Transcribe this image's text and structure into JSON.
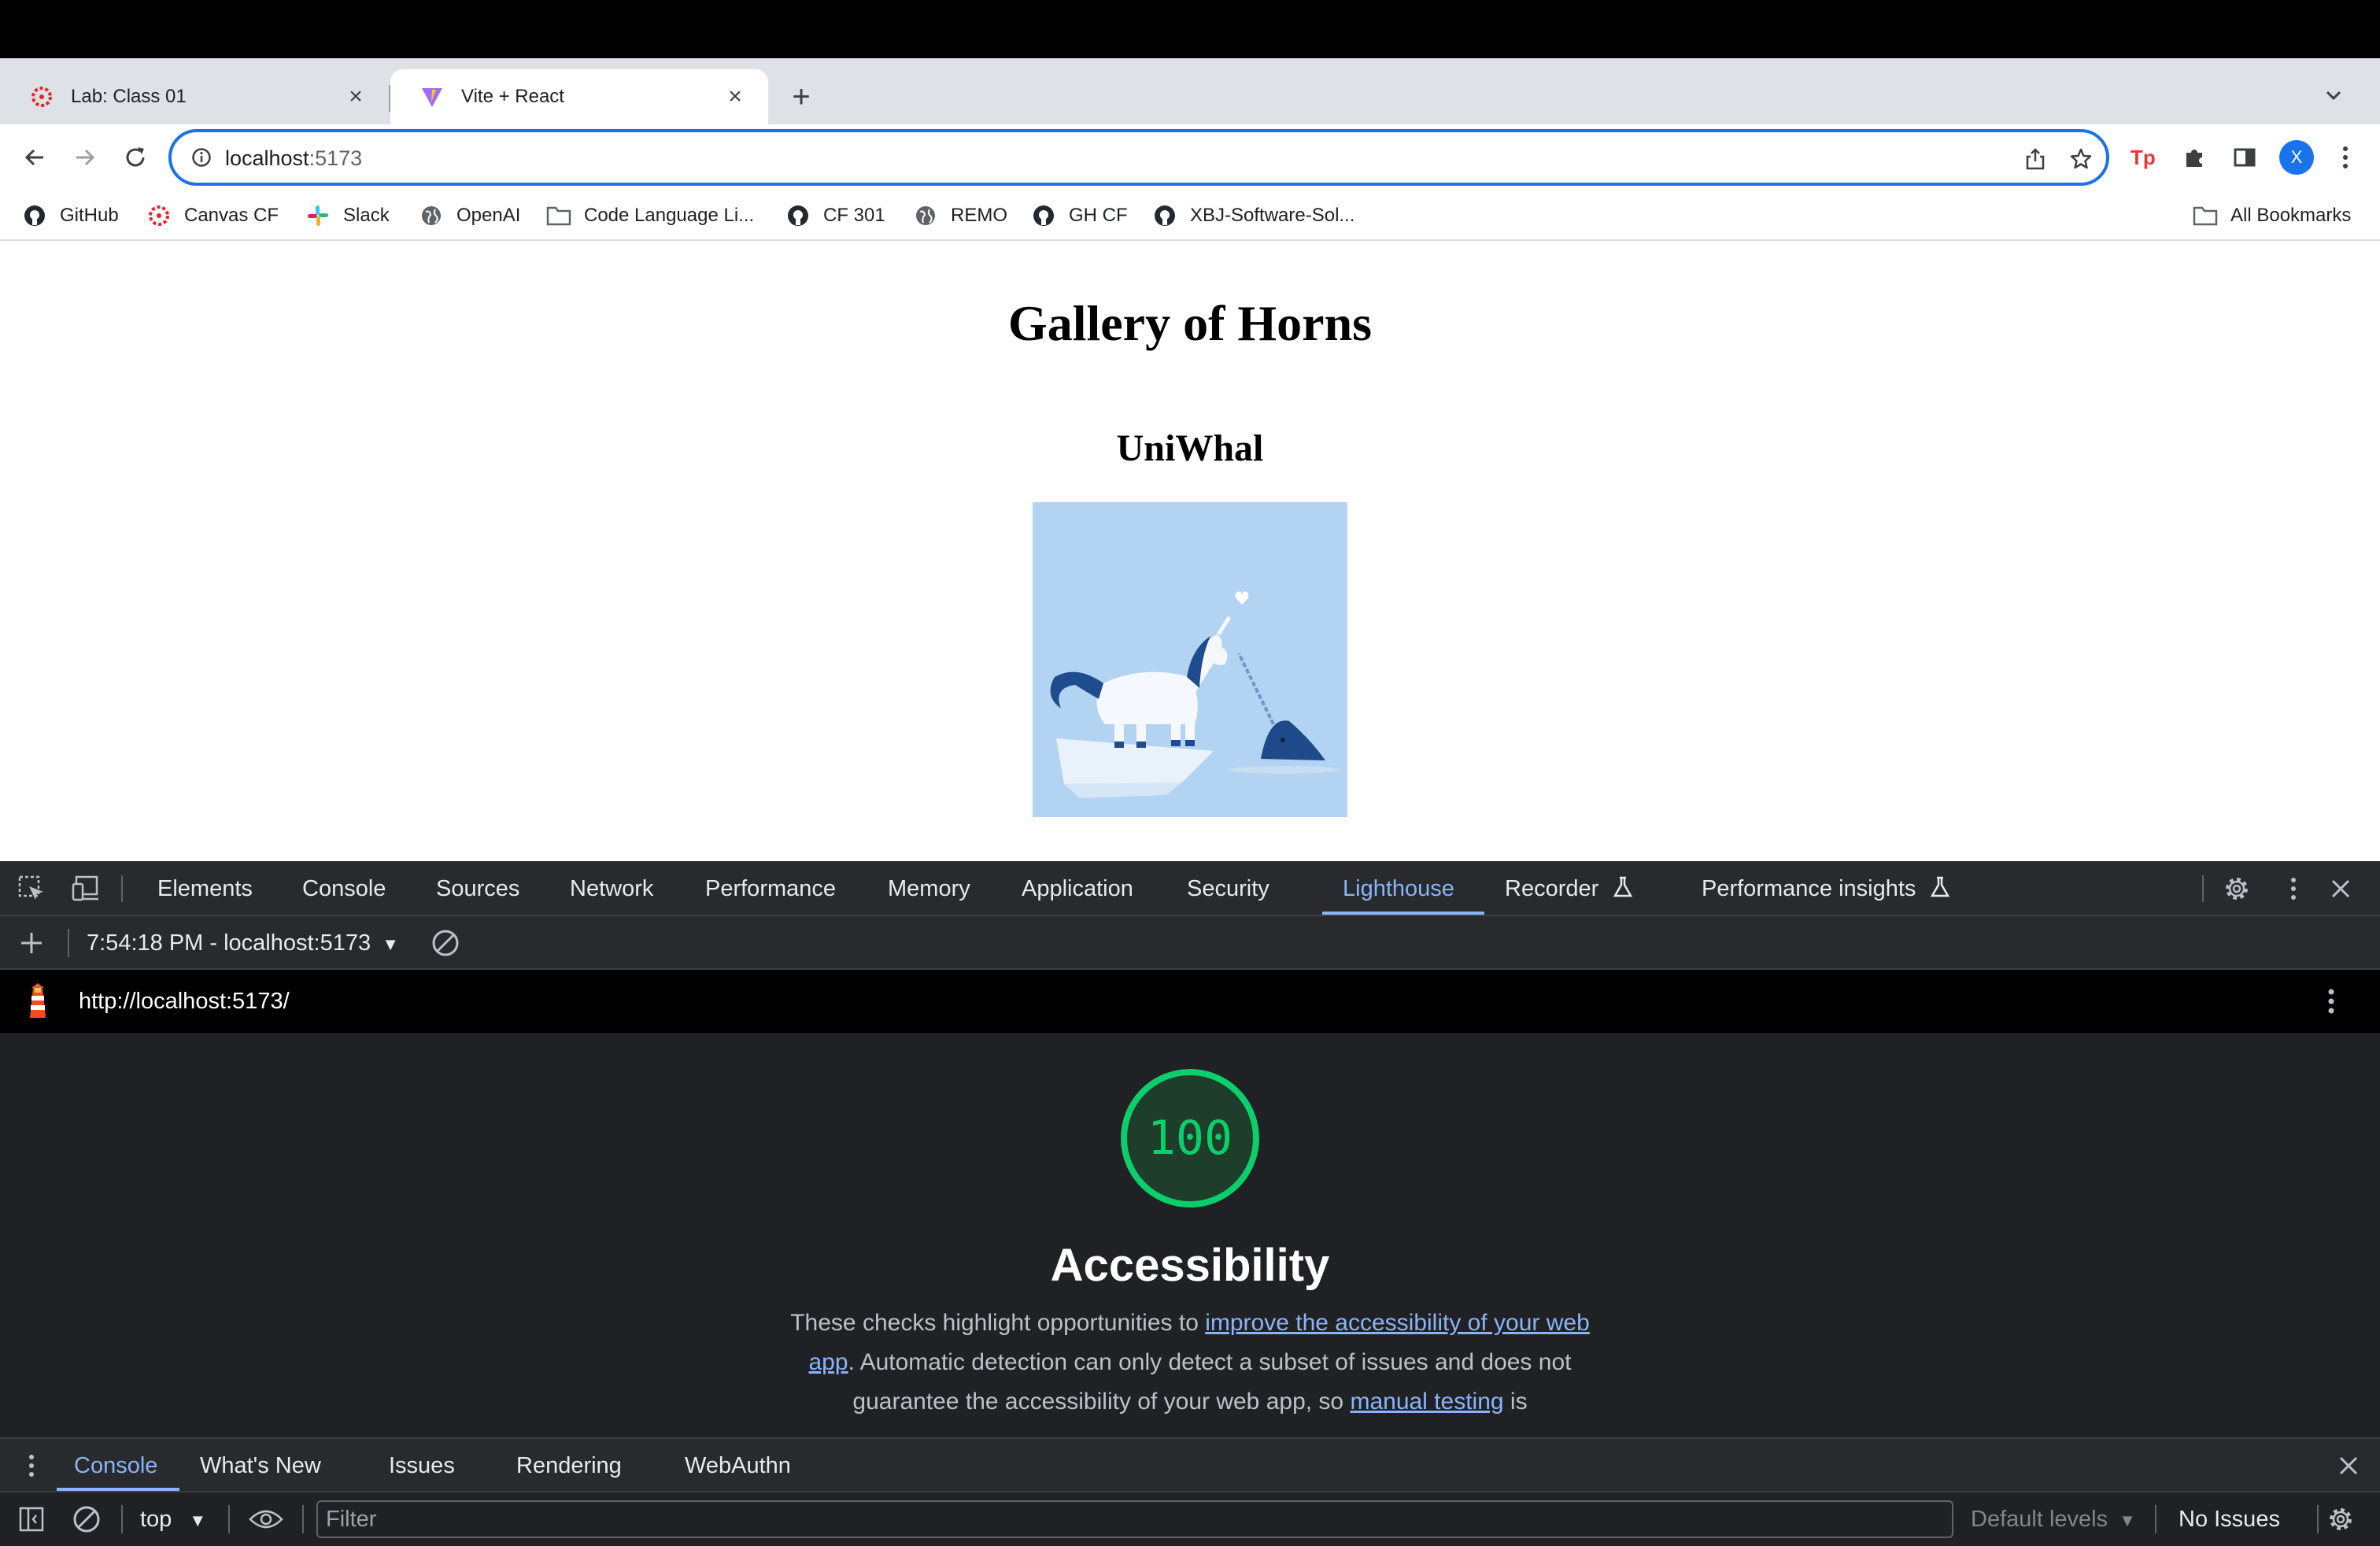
{
  "browser": {
    "tabs": [
      {
        "title": "Lab: Class 01",
        "favicon": "canvas-icon"
      },
      {
        "title": "Vite + React",
        "favicon": "vite-icon"
      }
    ],
    "url": {
      "host": "localhost",
      "port": ":5173"
    },
    "avatar_letter": "X",
    "bookmarks": [
      {
        "label": "GitHub",
        "icon": "github-icon"
      },
      {
        "label": "Canvas CF",
        "icon": "canvas-icon"
      },
      {
        "label": "Slack",
        "icon": "slack-icon"
      },
      {
        "label": "OpenAI",
        "icon": "globe-icon"
      },
      {
        "label": "Code Language Li...",
        "icon": "folder-icon"
      },
      {
        "label": "CF 301",
        "icon": "github-icon"
      },
      {
        "label": "REMO",
        "icon": "globe-icon"
      },
      {
        "label": "GH CF",
        "icon": "github-icon"
      },
      {
        "label": "XBJ-Software-Sol...",
        "icon": "github-icon"
      }
    ],
    "all_bookmarks_label": "All Bookmarks"
  },
  "page": {
    "title": "Gallery of Horns",
    "beast_title": "UniWhal",
    "image_alt": "UniWhal"
  },
  "devtools": {
    "tabs": [
      "Elements",
      "Console",
      "Sources",
      "Network",
      "Performance",
      "Memory",
      "Application",
      "Security",
      "Lighthouse",
      "Recorder",
      "Performance insights"
    ],
    "active_tab": "Lighthouse",
    "report_select": "7:54:18 PM - localhost:5173",
    "report_url": "http://localhost:5173/",
    "score": "100",
    "category_title": "Accessibility",
    "description": {
      "part1": "These checks highlight opportunities to ",
      "link1": "improve the accessibility of your web app",
      "part2": ". Automatic detection can only detect a subset of issues and does not guarantee the accessibility of your web app, so ",
      "link2": "manual testing",
      "part3": " is"
    },
    "drawer_tabs": [
      "Console",
      "What's New",
      "Issues",
      "Rendering",
      "WebAuthn"
    ],
    "console": {
      "context": "top",
      "filter_placeholder": "Filter",
      "levels": "Default levels",
      "issues": "No Issues"
    },
    "colors": {
      "accent": "#8ab4f8",
      "score_pass": "#0cce6b",
      "omnibox_border": "#1a73e8"
    }
  }
}
